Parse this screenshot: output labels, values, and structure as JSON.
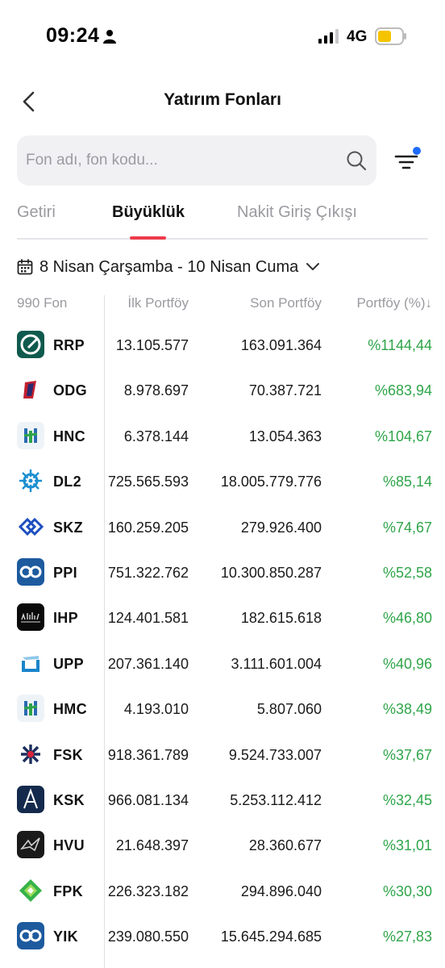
{
  "status_bar": {
    "time": "09:24",
    "network": "4G"
  },
  "header": {
    "title": "Yatırım Fonları"
  },
  "search": {
    "placeholder": "Fon adı, fon kodu..."
  },
  "tabs": [
    {
      "label": "Getiri",
      "active": false
    },
    {
      "label": "Büyüklük",
      "active": true
    },
    {
      "label": "Nakit Giriş Çıkışı",
      "active": false
    }
  ],
  "date_range": {
    "label": "8 Nisan Çarşamba - 10 Nisan Cuma"
  },
  "table": {
    "headers": {
      "count": "990 Fon",
      "ilk": "İlk Portföy",
      "son": "Son Portföy",
      "pct": "Portföy (%)↓"
    },
    "rows": [
      {
        "code": "RRP",
        "ilk": "13.105.577",
        "son": "163.091.364",
        "pct": "%1144,44",
        "icon": "rrp-logo-icon"
      },
      {
        "code": "ODG",
        "ilk": "8.978.697",
        "son": "70.387.721",
        "pct": "%683,94",
        "icon": "odg-logo-icon"
      },
      {
        "code": "HNC",
        "ilk": "6.378.144",
        "son": "13.054.363",
        "pct": "%104,67",
        "icon": "hnc-logo-icon"
      },
      {
        "code": "DL2",
        "ilk": "725.565.593",
        "son": "18.005.779.776",
        "pct": "%85,14",
        "icon": "dl2-logo-icon"
      },
      {
        "code": "SKZ",
        "ilk": "160.259.205",
        "son": "279.926.400",
        "pct": "%74,67",
        "icon": "skz-logo-icon"
      },
      {
        "code": "PPI",
        "ilk": "751.322.762",
        "son": "10.300.850.287",
        "pct": "%52,58",
        "icon": "ppi-logo-icon"
      },
      {
        "code": "IHP",
        "ilk": "124.401.581",
        "son": "182.615.618",
        "pct": "%46,80",
        "icon": "ihp-logo-icon"
      },
      {
        "code": "UPP",
        "ilk": "207.361.140",
        "son": "3.111.601.004",
        "pct": "%40,96",
        "icon": "upp-logo-icon"
      },
      {
        "code": "HMC",
        "ilk": "4.193.010",
        "son": "5.807.060",
        "pct": "%38,49",
        "icon": "hmc-logo-icon"
      },
      {
        "code": "FSK",
        "ilk": "918.361.789",
        "son": "9.524.733.007",
        "pct": "%37,67",
        "icon": "fsk-logo-icon"
      },
      {
        "code": "KSK",
        "ilk": "966.081.134",
        "son": "5.253.112.412",
        "pct": "%32,45",
        "icon": "ksk-logo-icon"
      },
      {
        "code": "HVU",
        "ilk": "21.648.397",
        "son": "28.360.677",
        "pct": "%31,01",
        "icon": "hvu-logo-icon"
      },
      {
        "code": "FPK",
        "ilk": "226.323.182",
        "son": "294.896.040",
        "pct": "%30,30",
        "icon": "fpk-logo-icon"
      },
      {
        "code": "YIK",
        "ilk": "239.080.550",
        "son": "15.645.294.685",
        "pct": "%27,83",
        "icon": "yik-logo-icon"
      }
    ]
  },
  "colors": {
    "accent": "#ec3b4b",
    "positive": "#2fa54a",
    "muted": "#9a9aa0",
    "filter_dot": "#1f6bff"
  }
}
